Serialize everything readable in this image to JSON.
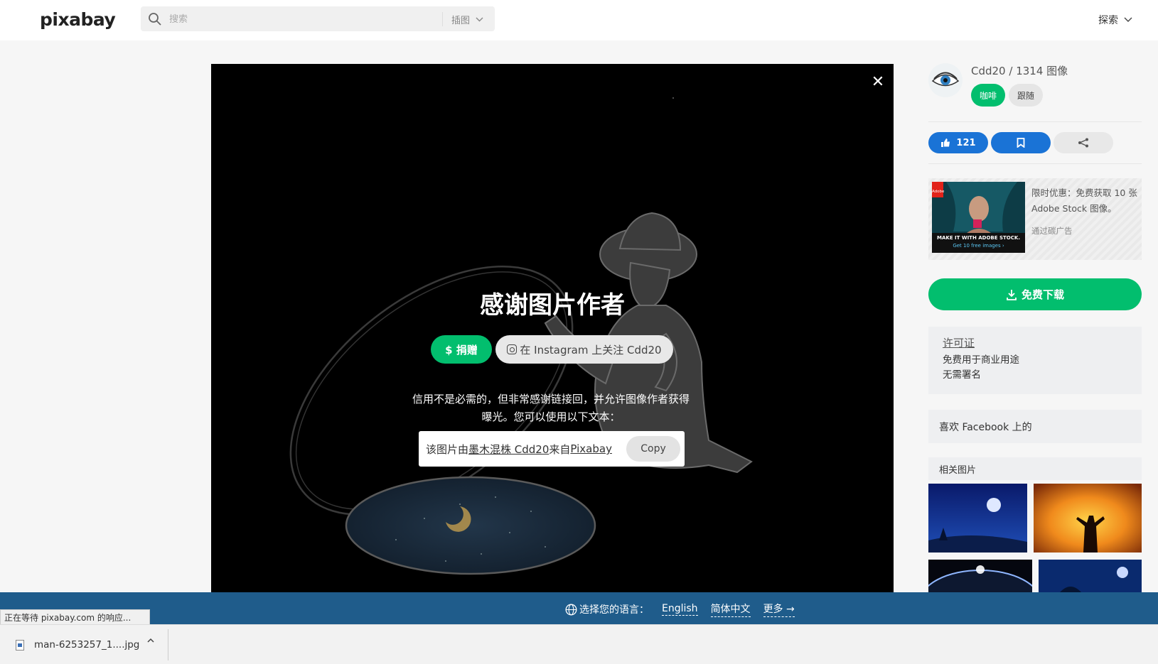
{
  "header": {
    "logo": "pixabay",
    "search_placeholder": "搜索",
    "search_type": "插图",
    "explore": "探索"
  },
  "modal": {
    "title": "感谢图片作者",
    "donate": "$ 捐赠",
    "instagram": "在 Instagram 上关注 Cdd20",
    "credit_line1": "信用不是必需的，但非常感谢链接回，并允许图像作者获得",
    "credit_line2": "曝光。您可以使用以下文本：",
    "attribution_prefix": "该图片由",
    "attribution_author": "墨木混株 Cdd20",
    "attribution_mid": "来自",
    "attribution_site": "Pixabay",
    "copy": "Copy"
  },
  "sidebar": {
    "author": "Cdd20 / 1314 图像",
    "coffee": "咖啡",
    "follow": "跟随",
    "likes": "121",
    "ad_text": "限时优惠：免费获取 10 张 Adobe Stock 图像。",
    "ad_via": "通过碳广告",
    "ad_banner_line1": "MAKE IT WITH ADOBE STOCK.",
    "ad_banner_line2": "Get 10 free images ›",
    "ad_logo": "Adobe",
    "download": "免费下载",
    "license_title": "许可证",
    "license_line1": "免费用于商业用途",
    "license_line2": "无需署名",
    "facebook": "喜欢 Facebook 上的",
    "related": "相关图片"
  },
  "lang_bar": {
    "label": "选择您的语言：",
    "english": "English",
    "chinese": "简体中文",
    "more": "更多 →"
  },
  "status": "正在等待 pixabay.com 的响应...",
  "download_shelf": {
    "filename": "man-6253257_1....jpg"
  }
}
